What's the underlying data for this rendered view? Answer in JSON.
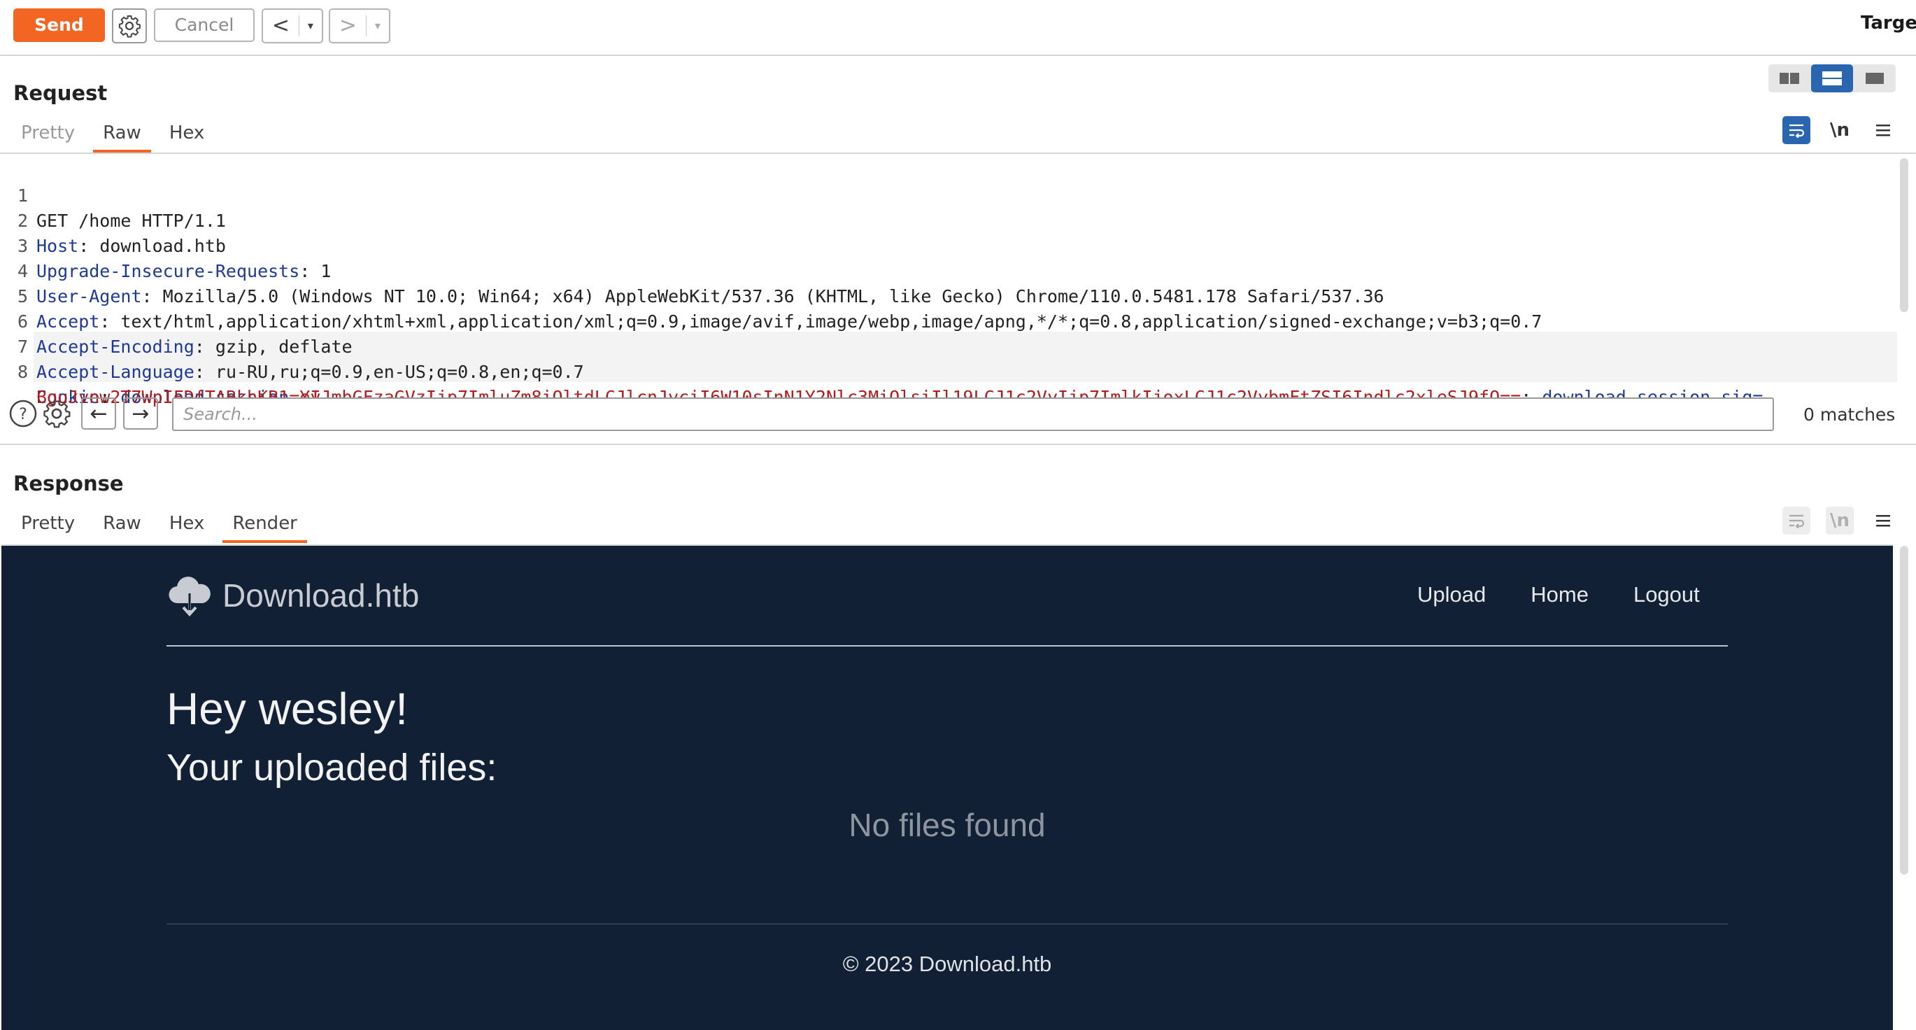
{
  "toolbar": {
    "send_label": "Send",
    "cancel_label": "Cancel",
    "back_arrow": "<",
    "forward_arrow": ">",
    "dropdown_glyph": "▾",
    "target_label": "Target"
  },
  "request": {
    "title": "Request",
    "tabs": [
      "Pretty",
      "Raw",
      "Hex"
    ],
    "active_tab": "Raw",
    "newline_toggle": "\\n",
    "lines": [
      {
        "num": "1",
        "name": "",
        "sep": "",
        "value": "GET /home HTTP/1.1"
      },
      {
        "num": "2",
        "name": "Host",
        "sep": ": ",
        "value": "download.htb"
      },
      {
        "num": "3",
        "name": "Upgrade-Insecure-Requests",
        "sep": ": ",
        "value": "1"
      },
      {
        "num": "4",
        "name": "User-Agent",
        "sep": ": ",
        "value": "Mozilla/5.0 (Windows NT 10.0; Win64; x64) AppleWebKit/537.36 (KHTML, like Gecko) Chrome/110.0.5481.178 Safari/537.36"
      },
      {
        "num": "5",
        "name": "Accept",
        "sep": ": ",
        "value": "text/html,application/xhtml+xml,application/xml;q=0.9,image/avif,image/webp,image/apng,*/*;q=0.8,application/signed-exchange;v=b3;q=0.7"
      },
      {
        "num": "6",
        "name": "Accept-Encoding",
        "sep": ": ",
        "value": "gzip, deflate"
      },
      {
        "num": "7",
        "name": "Accept-Language",
        "sep": ": ",
        "value": "ru-RU,ru;q=0.9,en-US;q=0.8,en;q=0.7"
      }
    ],
    "cookie": {
      "num": "8",
      "name": "Cookie",
      "sep": ": ",
      "c1_name": "download_session",
      "c1_value": "eyJmbGFzaGVzIjp7ImluZm8iOltdLCJlcnJvciI6W10sInN1Y2Nlc3MiOlsiIl19LCJ1c2VyIjp7ImlkIjoxLCJ1c2VybmFtZSI6Indlc2xleSJ9fQ==",
      "c2_sep": "; ",
      "c2_name": "download_session.sig",
      "c2_eq": "=",
      "c2_value": "BguJvnw2T7WpIFDfTABkhKB1-YI"
    }
  },
  "search": {
    "placeholder": "Search...",
    "matches": "0 matches",
    "help_glyph": "?",
    "prev_glyph": "←",
    "next_glyph": "→"
  },
  "response": {
    "title": "Response",
    "tabs": [
      "Pretty",
      "Raw",
      "Hex",
      "Render"
    ],
    "active_tab": "Render",
    "newline_toggle": "\\n",
    "page": {
      "brand": "Download.htb",
      "nav": [
        "Upload",
        "Home",
        "Logout"
      ],
      "greeting": "Hey wesley!",
      "subheading": "Your uploaded files:",
      "empty_message": "No files found",
      "footer": "© 2023 Download.htb"
    }
  },
  "colors": {
    "accent": "#f26522",
    "selected_blue": "#2a66b0",
    "render_bg": "#112034",
    "header_name": "#1e3a96",
    "cookie_value": "#b21c1c"
  },
  "icons": [
    "gear-icon",
    "wrap-lines-icon",
    "hamburger-menu-icon",
    "help-icon",
    "cloud-download-icon",
    "layout-side-by-side-icon",
    "layout-stacked-icon",
    "layout-single-icon"
  ]
}
